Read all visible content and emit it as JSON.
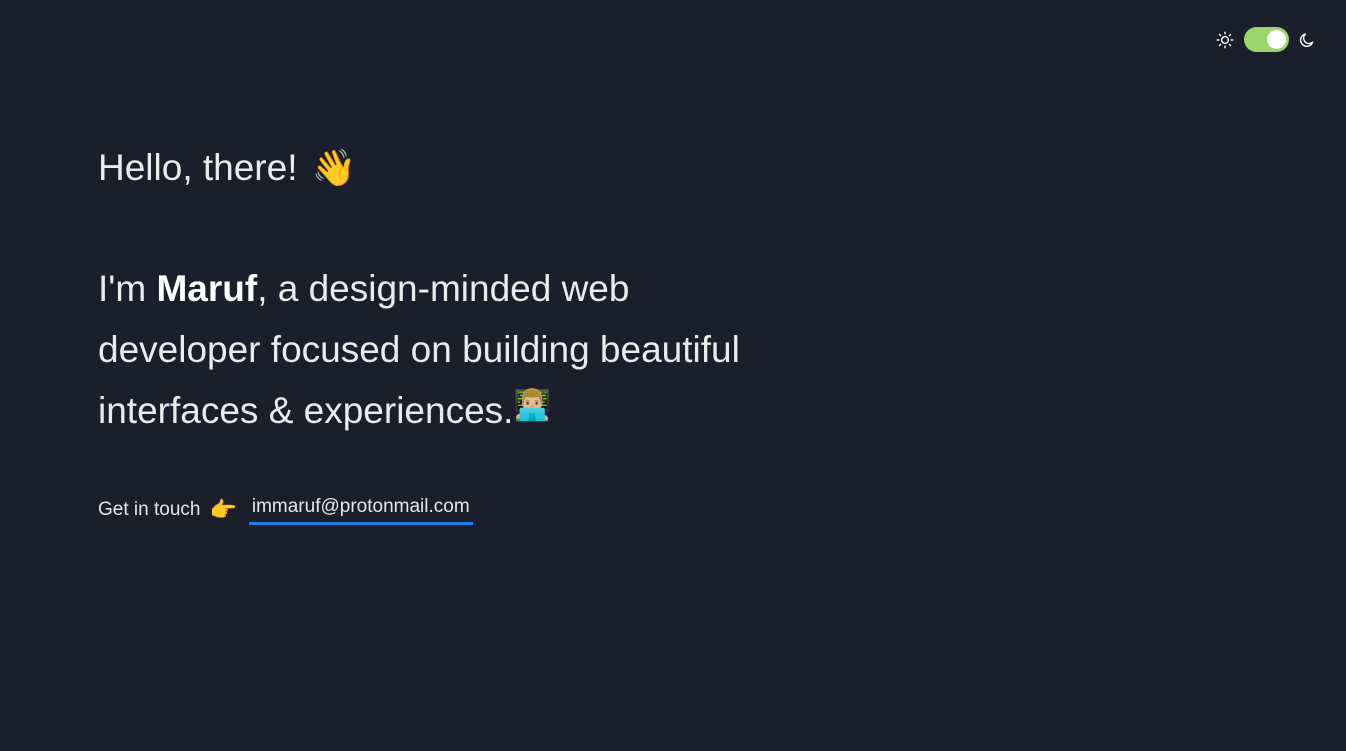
{
  "theme_toggle": {
    "light_icon": "sun-icon",
    "dark_icon": "moon-icon",
    "state": "dark",
    "track_color": "#9bd66b"
  },
  "greeting": {
    "text": "Hello, there!",
    "emoji": "👋"
  },
  "intro": {
    "prefix": "I'm ",
    "name": "Maruf",
    "suffix": ", a design-minded web developer focused on building beautiful interfaces & experiences.",
    "emoji": "👨🏼‍💻"
  },
  "contact": {
    "label": "Get in touch",
    "emoji": "👉",
    "email": "immaruf@protonmail.com",
    "link_underline_color": "#1f7aea"
  },
  "colors": {
    "background": "#1b1e2b",
    "text": "#ebebee"
  }
}
